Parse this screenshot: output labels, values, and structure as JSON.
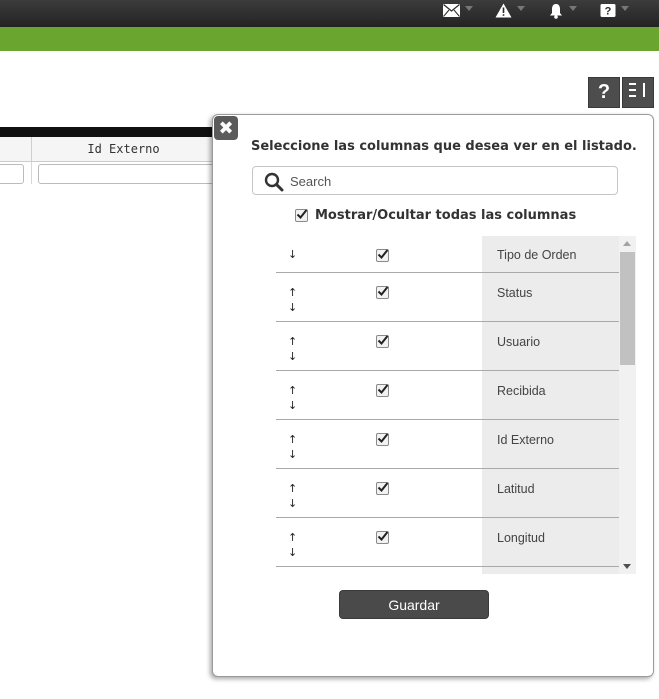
{
  "topbar": {
    "icons": [
      {
        "name": "mail-icon"
      },
      {
        "name": "warning-icon"
      },
      {
        "name": "bell-icon"
      },
      {
        "name": "help-icon"
      }
    ]
  },
  "colors": {
    "topbar": "#2e2e2e",
    "accent_bar": "#6aa52f",
    "button_dark": "#4d4d4d",
    "list_label_bg": "#ececec"
  },
  "toolbar": {
    "help_label": "?",
    "columns_icon": "columns-toggle-icon"
  },
  "background_table": {
    "column_header": "Id Externo"
  },
  "column_picker": {
    "title": "Seleccione las columnas que desea ver en el listado.",
    "search": {
      "placeholder": "Search",
      "value": ""
    },
    "toggle_all_label": "Mostrar/Ocultar todas las columnas",
    "toggle_all_checked": true,
    "columns": [
      {
        "label": "Tipo de Orden",
        "checked": true,
        "up": false,
        "down": true
      },
      {
        "label": "Status",
        "checked": true,
        "up": true,
        "down": true
      },
      {
        "label": "Usuario",
        "checked": true,
        "up": true,
        "down": true
      },
      {
        "label": "Recibida",
        "checked": true,
        "up": true,
        "down": true
      },
      {
        "label": "Id Externo",
        "checked": true,
        "up": true,
        "down": true
      },
      {
        "label": "Latitud",
        "checked": true,
        "up": true,
        "down": true
      },
      {
        "label": "Longitud",
        "checked": true,
        "up": true,
        "down": true
      }
    ],
    "arrow_up": "↑",
    "arrow_down": "↓",
    "save_label": "Guardar",
    "close_label": "✖"
  }
}
